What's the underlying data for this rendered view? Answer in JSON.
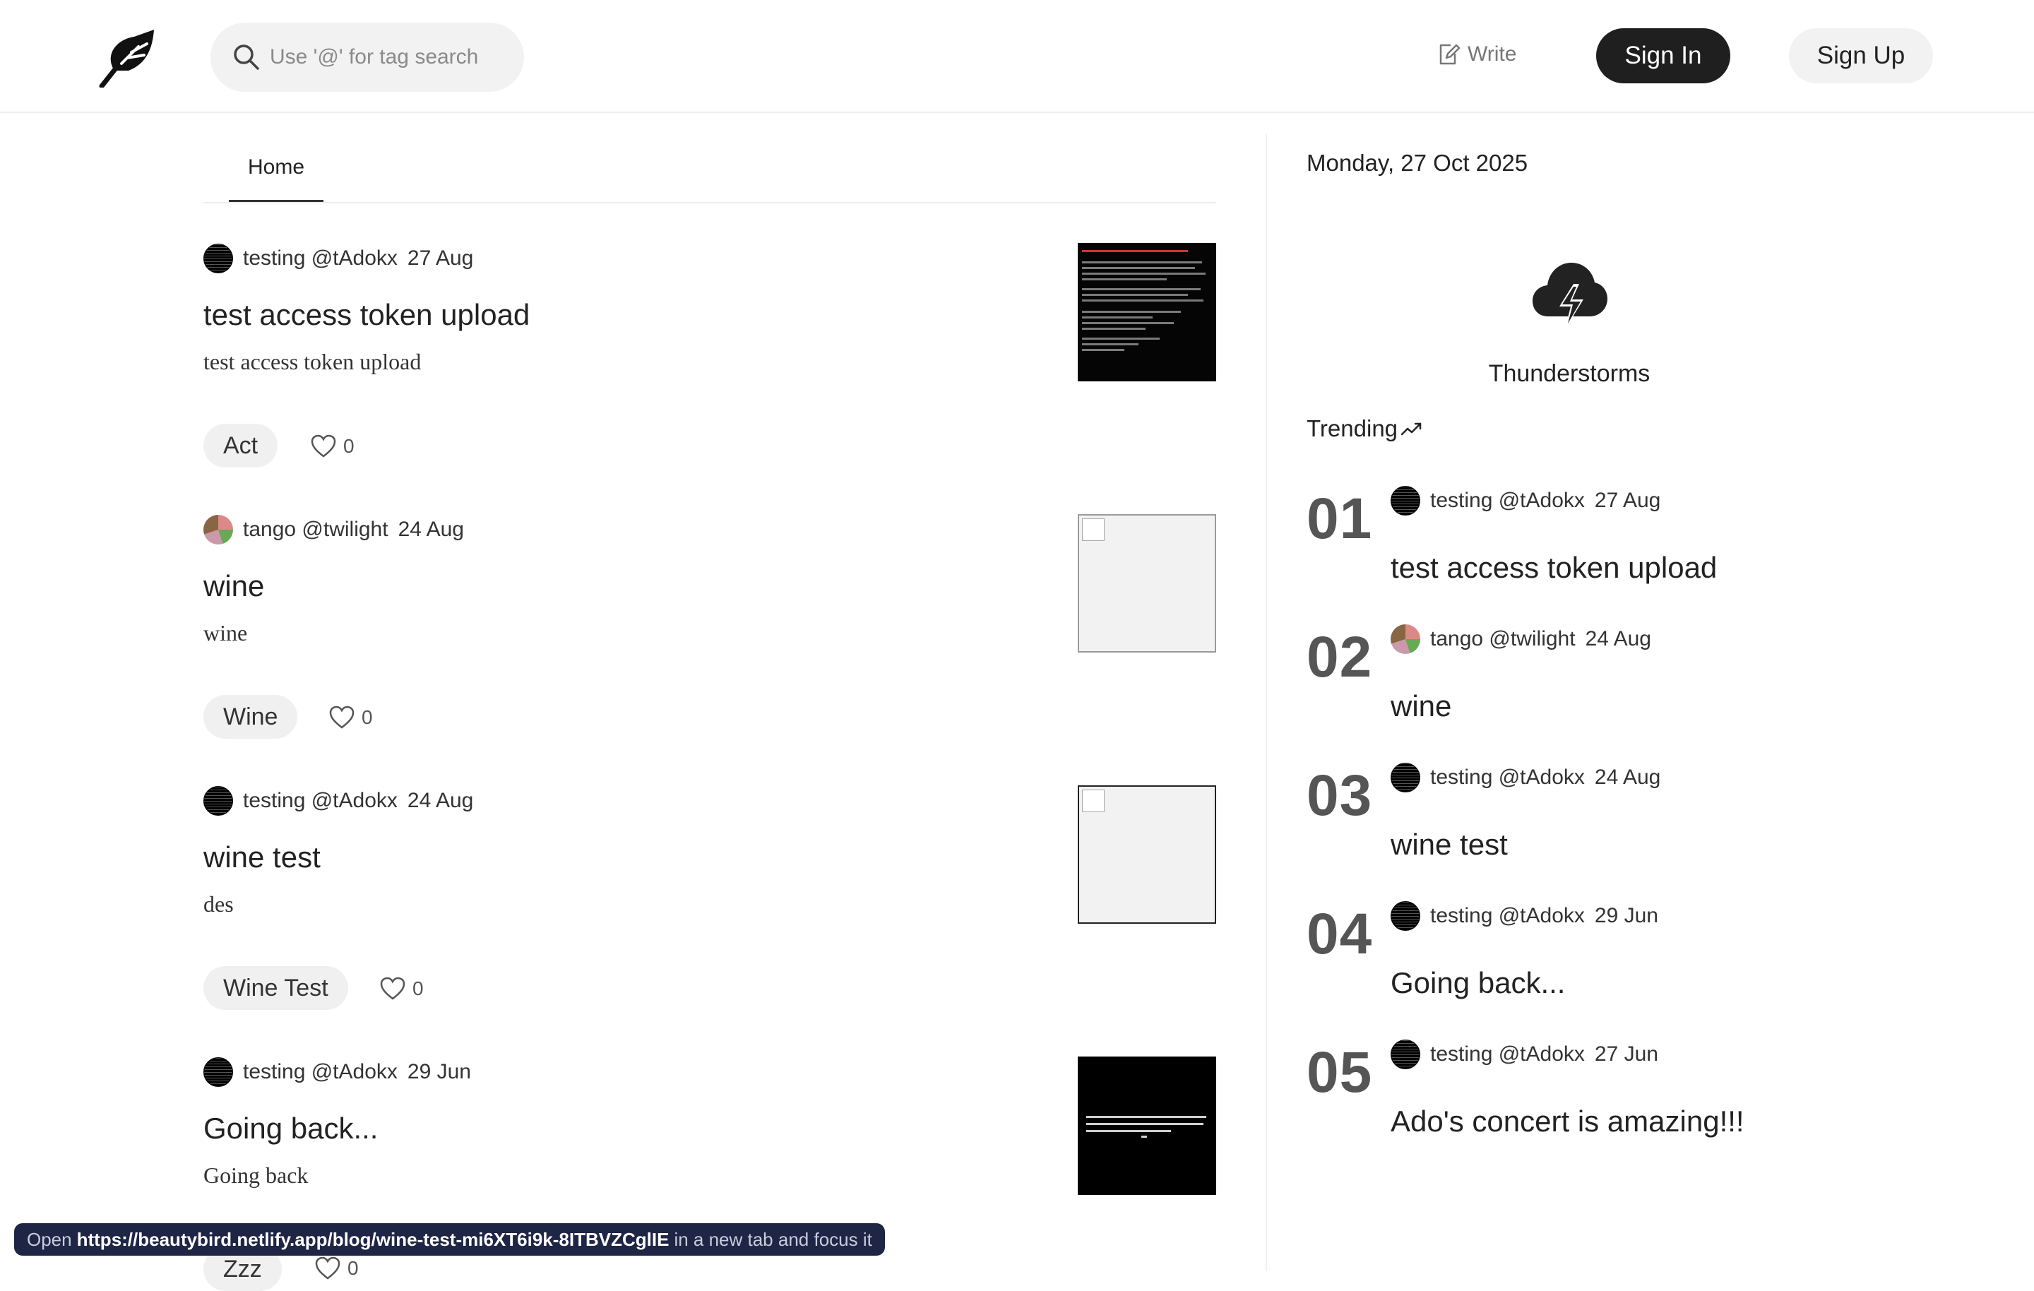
{
  "header": {
    "search_placeholder": "Use '@' for tag search",
    "write_label": "Write",
    "signin_label": "Sign In",
    "signup_label": "Sign Up"
  },
  "tabs": {
    "home": "Home"
  },
  "posts": [
    {
      "author": "testing @tAdokx",
      "date": "27 Aug",
      "title": "test access token upload",
      "excerpt": "test access token upload",
      "tag": "Act",
      "likes": "0"
    },
    {
      "author": "tango @twilight",
      "date": "24 Aug",
      "title": "wine",
      "excerpt": "wine",
      "tag": "Wine",
      "likes": "0"
    },
    {
      "author": "testing @tAdokx",
      "date": "24 Aug",
      "title": "wine test",
      "excerpt": "des",
      "tag": "Wine Test",
      "likes": "0"
    },
    {
      "author": "testing @tAdokx",
      "date": "29 Jun",
      "title": "Going back...",
      "excerpt": "Going back",
      "tag": "Zzz",
      "likes": "0"
    }
  ],
  "sidebar": {
    "date": "Monday, 27 Oct 2025",
    "weather": "Thunderstorms",
    "trending_label": "Trending",
    "trending": [
      {
        "num": "01",
        "author": "testing @tAdokx",
        "date": "27 Aug",
        "title": "test access token upload"
      },
      {
        "num": "02",
        "author": "tango @twilight",
        "date": "24 Aug",
        "title": "wine"
      },
      {
        "num": "03",
        "author": "testing @tAdokx",
        "date": "24 Aug",
        "title": "wine test"
      },
      {
        "num": "04",
        "author": "testing @tAdokx",
        "date": "29 Jun",
        "title": "Going back..."
      },
      {
        "num": "05",
        "author": "testing @tAdokx",
        "date": "27 Jun",
        "title": "Ado's concert is amazing!!!"
      }
    ]
  },
  "status_bar": {
    "prefix": "Open",
    "url": "https://beautybird.netlify.app/blog/wine-test-mi6XT6i9k-8ITBVZCglIE",
    "suffix": "in a new tab and focus it"
  },
  "icons": {
    "logo": "feather-leaf-icon",
    "search": "search-icon",
    "write": "edit-icon",
    "like": "heart-icon",
    "weather": "thunderstorm-icon",
    "trending": "trending-up-icon"
  }
}
